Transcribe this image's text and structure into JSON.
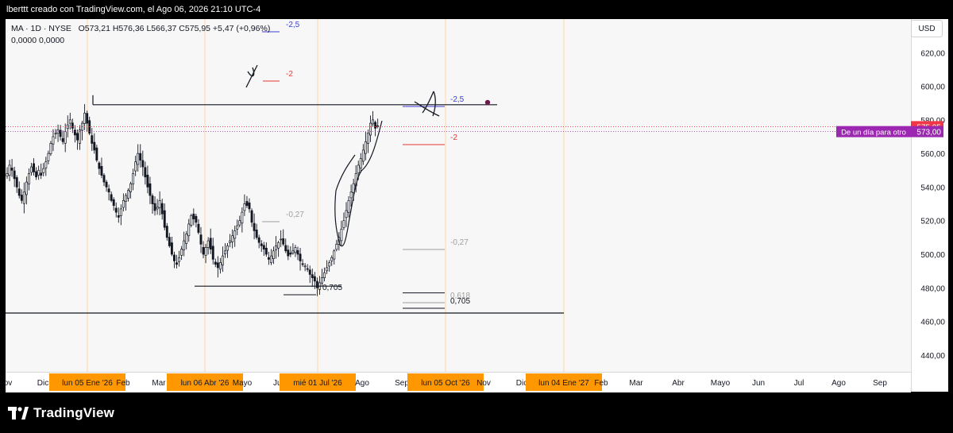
{
  "header": {
    "text": "lberttt creado con TradingView.com, el Ago 06, 2026 21:10 UTC-4"
  },
  "legend": {
    "symbol": "MA · 1D · NYSE",
    "ohlc": "O573,21  H576,36  L566,37  C575,95  +5,47 (+0,96%)",
    "indicator": "0,0000  0,0000"
  },
  "currency_button": "USD",
  "footer": {
    "brand": "TradingView"
  },
  "colors": {
    "up": "#131722",
    "down": "#131722",
    "price_label": "#f23645",
    "purple_label": "#9c27b0",
    "highlight": "#ff9800",
    "fib_blue": "#3d3dd6",
    "fib_red": "#e53935",
    "fib_gray": "#9e9e9e"
  },
  "chart_data": {
    "type": "candlestick",
    "symbol": "MA",
    "interval": "1D",
    "exchange": "NYSE",
    "ylim": [
      430,
      640
    ],
    "y_ticks": [
      "440,00",
      "460,00",
      "480,00",
      "500,00",
      "520,00",
      "540,00",
      "560,00",
      "580,00",
      "600,00",
      "620,00"
    ],
    "x_labels": [
      {
        "text": "ov",
        "highlight": false
      },
      {
        "text": "Dic",
        "highlight": false
      },
      {
        "text": "lun 05 Ene '26",
        "highlight": true
      },
      {
        "text": "Feb",
        "highlight": false
      },
      {
        "text": "Mar",
        "highlight": false
      },
      {
        "text": "lun 06 Abr '26",
        "highlight": true
      },
      {
        "text": "Mayo",
        "highlight": false
      },
      {
        "text": "Jun",
        "highlight": false
      },
      {
        "text": "mié 01 Jul '26",
        "highlight": true
      },
      {
        "text": "Ago",
        "highlight": false
      },
      {
        "text": "Sep",
        "highlight": false
      },
      {
        "text": "lun 05 Oct '26",
        "highlight": true
      },
      {
        "text": "Nov",
        "highlight": false
      },
      {
        "text": "Dic",
        "highlight": false
      },
      {
        "text": "lun 04 Ene '27",
        "highlight": true
      },
      {
        "text": "Feb",
        "highlight": false
      },
      {
        "text": "Mar",
        "highlight": false
      },
      {
        "text": "Abr",
        "highlight": false
      },
      {
        "text": "Mayo",
        "highlight": false
      },
      {
        "text": "Jun",
        "highlight": false
      },
      {
        "text": "Jul",
        "highlight": false
      },
      {
        "text": "Ago",
        "highlight": false
      },
      {
        "text": "Sep",
        "highlight": false
      }
    ],
    "close_series": [
      548,
      553,
      550,
      545,
      540,
      535,
      532,
      537,
      543,
      548,
      552,
      549,
      546,
      550,
      547,
      551,
      555,
      560,
      566,
      570,
      572,
      574,
      570,
      567,
      573,
      577,
      580,
      575,
      571,
      568,
      574,
      578,
      584,
      578,
      572,
      566,
      562,
      556,
      551,
      547,
      543,
      540,
      537,
      532,
      529,
      525,
      522,
      527,
      532,
      535,
      538,
      542,
      548,
      555,
      560,
      556,
      552,
      546,
      540,
      535,
      530,
      526,
      528,
      532,
      524,
      516,
      510,
      505,
      500,
      496,
      494,
      498,
      503,
      508,
      512,
      518,
      523,
      521,
      519,
      513,
      506,
      500,
      504,
      508,
      503,
      497,
      494,
      492,
      495,
      499,
      502,
      505,
      508,
      511,
      514,
      517,
      520,
      525,
      530,
      529,
      527,
      519,
      514,
      510,
      507,
      505,
      503,
      500,
      497,
      499,
      502,
      505,
      507,
      509,
      506,
      502,
      499,
      500,
      502,
      504,
      500,
      496,
      494,
      493,
      491,
      488,
      486,
      484,
      480,
      483,
      486,
      489,
      492,
      495,
      498,
      502,
      506,
      510,
      515,
      520,
      526,
      532,
      537,
      542,
      548,
      553,
      557,
      562,
      567,
      572,
      578,
      580,
      575,
      576
    ],
    "last_price": {
      "value": "575,95",
      "color": "#f23645"
    },
    "target_label": {
      "text": "De un día para otro",
      "value": "573,00"
    },
    "horizontal_levels": [
      {
        "price": 589
      },
      {
        "price": 481
      },
      {
        "price": 465
      }
    ],
    "fib_labels": [
      {
        "text": "-2,5",
        "color": "#3d3dd6"
      },
      {
        "text": "-2",
        "color": "#e53935"
      },
      {
        "text": "-2,5",
        "color": "#3d3dd6"
      },
      {
        "text": "-2",
        "color": "#e53935"
      },
      {
        "text": "-0,27",
        "color": "#9e9e9e"
      },
      {
        "text": "-0,27",
        "color": "#9e9e9e"
      },
      {
        "text": "0,618",
        "color": "#9e9e9e"
      },
      {
        "text": "0,705",
        "color": "#131722"
      },
      {
        "text": "0,705",
        "color": "#131722"
      }
    ]
  }
}
